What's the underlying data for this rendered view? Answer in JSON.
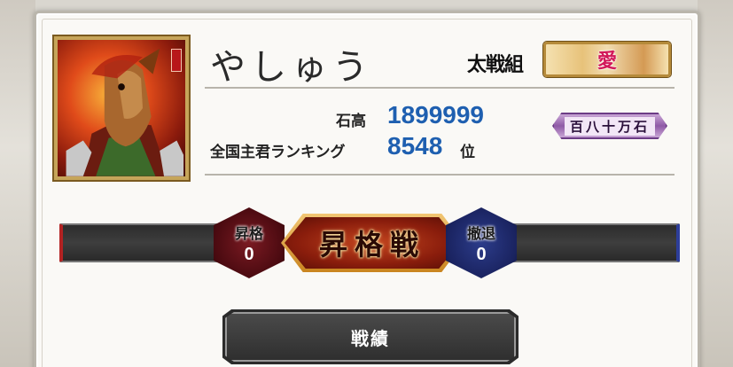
{
  "profile": {
    "name": "やしゅう",
    "guild_label": "太戦組",
    "guild_name": "愛"
  },
  "stats": {
    "kokudaka_label": "石高",
    "kokudaka_value": "1899999",
    "rank_label": "全国主君ランキング",
    "rank_value": "8548",
    "rank_unit": "位",
    "rank_title": "百八十万石"
  },
  "promotion": {
    "title": "昇格戦",
    "promote_label": "昇格",
    "promote_count": "0",
    "demote_label": "撤退",
    "demote_count": "0"
  },
  "buttons": {
    "record_label": "戦績"
  },
  "colors": {
    "value_blue": "#1e5fb0",
    "promo_red": "#8a1d0c",
    "demote_blue": "#1a2360",
    "panel_bg": "#faf9f6"
  }
}
